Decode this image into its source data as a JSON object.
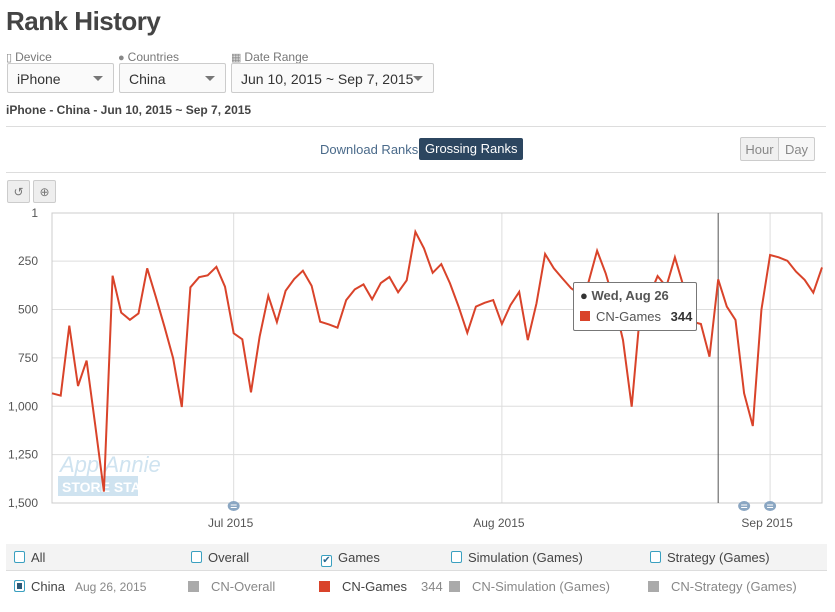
{
  "title": "Rank History",
  "filters": {
    "device": {
      "label": "Device",
      "value": "iPhone",
      "icon": "mobile-icon"
    },
    "countries": {
      "label": "Countries",
      "value": "China",
      "icon": "globe-icon"
    },
    "date_range": {
      "label": "Date Range",
      "value": "Jun 10, 2015 ~ Sep 7, 2015",
      "icon": "calendar-icon"
    }
  },
  "subtitle": "iPhone - China - Jun 10, 2015 ~ Sep 7, 2015",
  "rank_tabs": {
    "download": "Download Ranks",
    "grossing": "Grossing Ranks",
    "active": "grossing"
  },
  "granularity": {
    "hour": "Hour",
    "day": "Day"
  },
  "toolbar": {
    "reset_icon": "reset-zoom-icon",
    "zoom_icon": "zoom-in-icon"
  },
  "watermark": {
    "line1": "App Annie",
    "line2": "STORE STATS"
  },
  "tooltip": {
    "date": "Wed, Aug 26",
    "series": "CN-Games",
    "value": "344"
  },
  "colors": {
    "series": "#d9432a",
    "active_tab": "#2c4660",
    "weekend_band": "#f2f2f2",
    "checkbox": "#3aa0c0",
    "inactive_series": "#aaaaaa"
  },
  "legend": {
    "categories": [
      {
        "label": "All",
        "checked": false
      },
      {
        "label": "Overall",
        "checked": false
      },
      {
        "label": "Games",
        "checked": true
      },
      {
        "label": "Simulation (Games)",
        "checked": false
      },
      {
        "label": "Strategy (Games)",
        "checked": false
      }
    ],
    "country": {
      "label": "China",
      "date": "Aug 26, 2015"
    },
    "series": [
      {
        "label": "CN-Overall",
        "value": ""
      },
      {
        "label": "CN-Games",
        "value": "344"
      },
      {
        "label": "CN-Simulation (Games)",
        "value": ""
      },
      {
        "label": "CN-Strategy (Games)",
        "value": ""
      }
    ]
  },
  "chart_data": {
    "type": "line",
    "x_start": "2015-06-10",
    "x_end": "2015-09-07",
    "y_reversed": true,
    "ylim": [
      1,
      1500
    ],
    "yticks": [
      "1",
      "250",
      "500",
      "750",
      "1,000",
      "1,250",
      "1,500"
    ],
    "ytick_values": [
      1,
      250,
      500,
      750,
      1000,
      1250,
      1500
    ],
    "xticks": [
      {
        "label": "Jul 2015",
        "date": "2015-07-01"
      },
      {
        "label": "Aug 2015",
        "date": "2015-08-01"
      },
      {
        "label": "Sep 2015",
        "date": "2015-09-01"
      }
    ],
    "annotations": [
      "2015-07-01",
      "2015-08-29",
      "2015-09-01"
    ],
    "highlight_date": "2015-08-26",
    "weekend_bands": true,
    "grid": true,
    "series": [
      {
        "name": "CN-Games",
        "values": [
          933,
          945,
          583,
          895,
          764,
          1100,
          1441,
          325,
          516,
          553,
          520,
          287,
          434,
          589,
          751,
          1004,
          385,
          333,
          323,
          279,
          382,
          623,
          654,
          928,
          641,
          429,
          565,
          403,
          342,
          299,
          377,
          563,
          577,
          594,
          451,
          396,
          370,
          447,
          363,
          332,
          411,
          349,
          98,
          184,
          310,
          265,
          365,
          485,
          620,
          485,
          465,
          451,
          575,
          477,
          409,
          658,
          468,
          213,
          287,
          339,
          390,
          420,
          360,
          196,
          313,
          468,
          658,
          1002,
          502,
          434,
          327,
          382,
          230,
          382,
          563,
          575,
          744,
          344,
          485,
          554,
          933,
          1102,
          502,
          218,
          230,
          248,
          304,
          347,
          413,
          282
        ]
      }
    ]
  }
}
